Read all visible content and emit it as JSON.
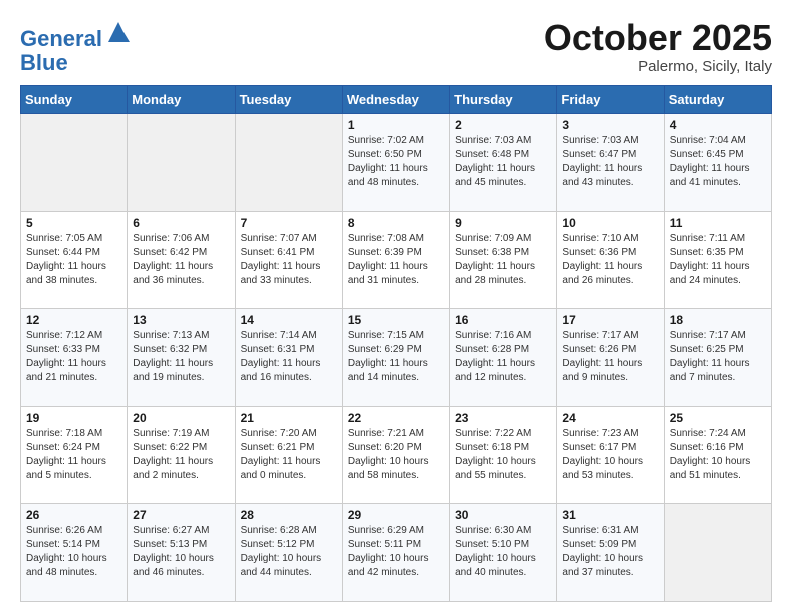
{
  "header": {
    "logo_line1": "General",
    "logo_line2": "Blue",
    "title": "October 2025",
    "subtitle": "Palermo, Sicily, Italy"
  },
  "days_of_week": [
    "Sunday",
    "Monday",
    "Tuesday",
    "Wednesday",
    "Thursday",
    "Friday",
    "Saturday"
  ],
  "weeks": [
    [
      {
        "day": "",
        "info": ""
      },
      {
        "day": "",
        "info": ""
      },
      {
        "day": "",
        "info": ""
      },
      {
        "day": "1",
        "info": "Sunrise: 7:02 AM\nSunset: 6:50 PM\nDaylight: 11 hours and 48 minutes."
      },
      {
        "day": "2",
        "info": "Sunrise: 7:03 AM\nSunset: 6:48 PM\nDaylight: 11 hours and 45 minutes."
      },
      {
        "day": "3",
        "info": "Sunrise: 7:03 AM\nSunset: 6:47 PM\nDaylight: 11 hours and 43 minutes."
      },
      {
        "day": "4",
        "info": "Sunrise: 7:04 AM\nSunset: 6:45 PM\nDaylight: 11 hours and 41 minutes."
      }
    ],
    [
      {
        "day": "5",
        "info": "Sunrise: 7:05 AM\nSunset: 6:44 PM\nDaylight: 11 hours and 38 minutes."
      },
      {
        "day": "6",
        "info": "Sunrise: 7:06 AM\nSunset: 6:42 PM\nDaylight: 11 hours and 36 minutes."
      },
      {
        "day": "7",
        "info": "Sunrise: 7:07 AM\nSunset: 6:41 PM\nDaylight: 11 hours and 33 minutes."
      },
      {
        "day": "8",
        "info": "Sunrise: 7:08 AM\nSunset: 6:39 PM\nDaylight: 11 hours and 31 minutes."
      },
      {
        "day": "9",
        "info": "Sunrise: 7:09 AM\nSunset: 6:38 PM\nDaylight: 11 hours and 28 minutes."
      },
      {
        "day": "10",
        "info": "Sunrise: 7:10 AM\nSunset: 6:36 PM\nDaylight: 11 hours and 26 minutes."
      },
      {
        "day": "11",
        "info": "Sunrise: 7:11 AM\nSunset: 6:35 PM\nDaylight: 11 hours and 24 minutes."
      }
    ],
    [
      {
        "day": "12",
        "info": "Sunrise: 7:12 AM\nSunset: 6:33 PM\nDaylight: 11 hours and 21 minutes."
      },
      {
        "day": "13",
        "info": "Sunrise: 7:13 AM\nSunset: 6:32 PM\nDaylight: 11 hours and 19 minutes."
      },
      {
        "day": "14",
        "info": "Sunrise: 7:14 AM\nSunset: 6:31 PM\nDaylight: 11 hours and 16 minutes."
      },
      {
        "day": "15",
        "info": "Sunrise: 7:15 AM\nSunset: 6:29 PM\nDaylight: 11 hours and 14 minutes."
      },
      {
        "day": "16",
        "info": "Sunrise: 7:16 AM\nSunset: 6:28 PM\nDaylight: 11 hours and 12 minutes."
      },
      {
        "day": "17",
        "info": "Sunrise: 7:17 AM\nSunset: 6:26 PM\nDaylight: 11 hours and 9 minutes."
      },
      {
        "day": "18",
        "info": "Sunrise: 7:17 AM\nSunset: 6:25 PM\nDaylight: 11 hours and 7 minutes."
      }
    ],
    [
      {
        "day": "19",
        "info": "Sunrise: 7:18 AM\nSunset: 6:24 PM\nDaylight: 11 hours and 5 minutes."
      },
      {
        "day": "20",
        "info": "Sunrise: 7:19 AM\nSunset: 6:22 PM\nDaylight: 11 hours and 2 minutes."
      },
      {
        "day": "21",
        "info": "Sunrise: 7:20 AM\nSunset: 6:21 PM\nDaylight: 11 hours and 0 minutes."
      },
      {
        "day": "22",
        "info": "Sunrise: 7:21 AM\nSunset: 6:20 PM\nDaylight: 10 hours and 58 minutes."
      },
      {
        "day": "23",
        "info": "Sunrise: 7:22 AM\nSunset: 6:18 PM\nDaylight: 10 hours and 55 minutes."
      },
      {
        "day": "24",
        "info": "Sunrise: 7:23 AM\nSunset: 6:17 PM\nDaylight: 10 hours and 53 minutes."
      },
      {
        "day": "25",
        "info": "Sunrise: 7:24 AM\nSunset: 6:16 PM\nDaylight: 10 hours and 51 minutes."
      }
    ],
    [
      {
        "day": "26",
        "info": "Sunrise: 6:26 AM\nSunset: 5:14 PM\nDaylight: 10 hours and 48 minutes."
      },
      {
        "day": "27",
        "info": "Sunrise: 6:27 AM\nSunset: 5:13 PM\nDaylight: 10 hours and 46 minutes."
      },
      {
        "day": "28",
        "info": "Sunrise: 6:28 AM\nSunset: 5:12 PM\nDaylight: 10 hours and 44 minutes."
      },
      {
        "day": "29",
        "info": "Sunrise: 6:29 AM\nSunset: 5:11 PM\nDaylight: 10 hours and 42 minutes."
      },
      {
        "day": "30",
        "info": "Sunrise: 6:30 AM\nSunset: 5:10 PM\nDaylight: 10 hours and 40 minutes."
      },
      {
        "day": "31",
        "info": "Sunrise: 6:31 AM\nSunset: 5:09 PM\nDaylight: 10 hours and 37 minutes."
      },
      {
        "day": "",
        "info": ""
      }
    ]
  ]
}
